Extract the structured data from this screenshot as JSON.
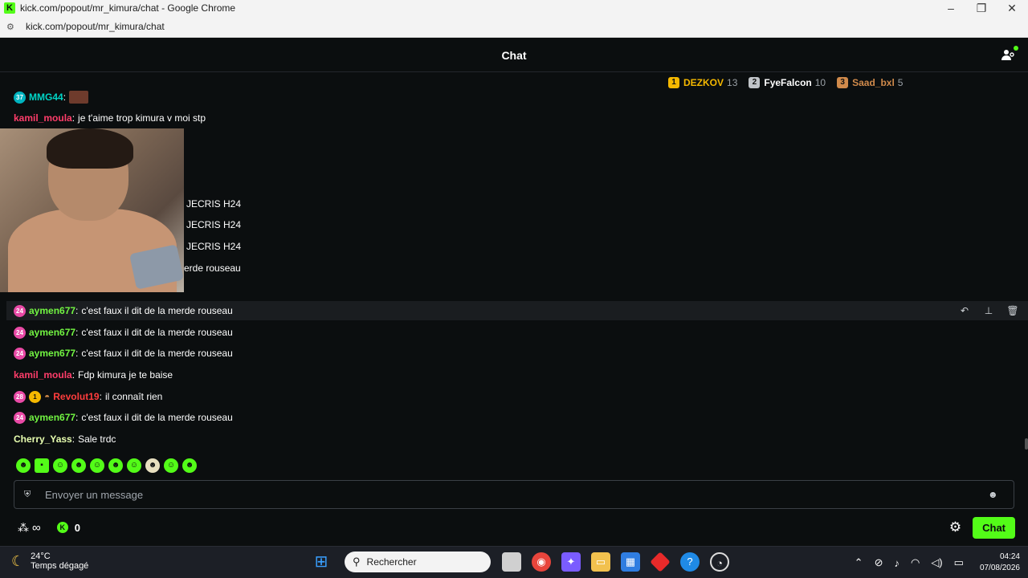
{
  "window": {
    "title": "kick.com/popout/mr_kimura/chat - Google Chrome",
    "url": "kick.com/popout/mr_kimura/chat",
    "controls": [
      "minimize",
      "restore",
      "close"
    ]
  },
  "chat": {
    "header_title": "Chat",
    "leaderboard": [
      {
        "rank": "1",
        "name": "DEZKOV",
        "count": "13",
        "color": "#f5b800"
      },
      {
        "rank": "2",
        "name": "FyeFalcon",
        "count": "10",
        "color": "#c0c4c8"
      },
      {
        "rank": "3",
        "name": "Saad_bxl",
        "count": "5",
        "color": "#d08a4b"
      }
    ],
    "messages": [
      {
        "badges": [
          "37"
        ],
        "user": "MMG44",
        "color": "#00d4c6",
        "text": "",
        "top_partial": true
      },
      {
        "badges": [],
        "user": "kamil_moula",
        "color": "#ff3d6a",
        "text": "je t'aime trop kimura v moi stp"
      },
      {
        "badges": [],
        "user": "",
        "color": "#ffffff",
        "text": "JECRIS H24"
      },
      {
        "badges": [],
        "user": "",
        "color": "#ffffff",
        "text": "JECRIS H24"
      },
      {
        "badges": [],
        "user": "",
        "color": "#ffffff",
        "text": "JECRIS H24"
      },
      {
        "badges": [],
        "user": "",
        "color": "#ffffff",
        "text": "erde rouseau"
      },
      {
        "badges": [
          "24"
        ],
        "user": "aymen677",
        "color": "#72f542",
        "text": "c'est faux il dit de la merde rouseau"
      },
      {
        "badges": [
          "24"
        ],
        "user": "aymen677",
        "color": "#72f542",
        "text": "c'est faux il dit de la merde rouseau"
      },
      {
        "badges": [
          "24"
        ],
        "user": "aymen677",
        "color": "#72f542",
        "text": "c'est faux il dit de la merde rouseau"
      },
      {
        "badges": [],
        "user": "kamil_moula",
        "color": "#ff3d6a",
        "text": "Fdp kimura je te baise"
      },
      {
        "badges": [
          "28",
          "1",
          "hat"
        ],
        "user": "Revolut19",
        "color": "#ff3d3d",
        "text": "il connaît rien"
      },
      {
        "badges": [
          "24"
        ],
        "user": "aymen677",
        "color": "#72f542",
        "text": "c'est faux il dit de la merde rouseau"
      },
      {
        "badges": [],
        "user": "Cherry_Yass",
        "color": "#e8ffb0",
        "text": "Sale trdc"
      }
    ],
    "hover_actions": [
      "reply-icon",
      "pin-icon",
      "delete-icon"
    ],
    "emotes": [
      "emote-1",
      "emote-2",
      "emote-3",
      "emote-4",
      "emote-5",
      "emote-6",
      "emote-7",
      "emote-8",
      "emote-9",
      "emote-10"
    ],
    "composer_placeholder": "Envoyer un message",
    "points_value": "0",
    "send_label": "Chat",
    "accent": "#53fc18"
  },
  "taskbar": {
    "temperature": "24°C",
    "weather": "Temps dégagé",
    "search_placeholder": "Rechercher",
    "time": "04:24",
    "date": "07/08/2026"
  }
}
